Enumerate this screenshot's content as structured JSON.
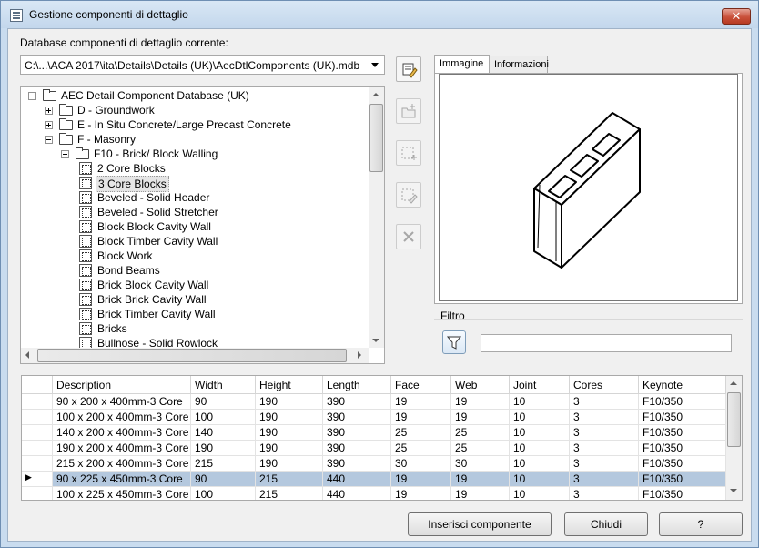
{
  "window": {
    "title": "Gestione componenti di dettaglio",
    "close_glyph": "✕"
  },
  "database": {
    "label": "Database componenti di dettaglio corrente:",
    "value": "C:\\...\\ACA 2017\\ita\\Details\\Details (UK)\\AecDtlComponents (UK).mdb"
  },
  "tree": {
    "items": [
      {
        "label": "AEC Detail Component Database (UK)",
        "level": 0,
        "toggle": "minus",
        "icon": "folder"
      },
      {
        "label": "D - Groundwork",
        "level": 1,
        "toggle": "plus",
        "icon": "folder"
      },
      {
        "label": "E - In Situ Concrete/Large Precast Concrete",
        "level": 1,
        "toggle": "plus",
        "icon": "folder"
      },
      {
        "label": "F - Masonry",
        "level": 1,
        "toggle": "minus",
        "icon": "folder"
      },
      {
        "label": "F10 - Brick/ Block Walling",
        "level": 2,
        "toggle": "minus",
        "icon": "folder"
      },
      {
        "label": "2 Core Blocks",
        "level": 3,
        "toggle": "",
        "icon": "component"
      },
      {
        "label": "3 Core Blocks",
        "level": 3,
        "toggle": "",
        "icon": "component",
        "selected": true
      },
      {
        "label": "Beveled - Solid Header",
        "level": 3,
        "toggle": "",
        "icon": "component"
      },
      {
        "label": "Beveled - Solid Stretcher",
        "level": 3,
        "toggle": "",
        "icon": "component"
      },
      {
        "label": "Block Block Cavity Wall",
        "level": 3,
        "toggle": "",
        "icon": "component"
      },
      {
        "label": "Block Timber Cavity Wall",
        "level": 3,
        "toggle": "",
        "icon": "component"
      },
      {
        "label": "Block Work",
        "level": 3,
        "toggle": "",
        "icon": "component"
      },
      {
        "label": "Bond Beams",
        "level": 3,
        "toggle": "",
        "icon": "component"
      },
      {
        "label": "Brick Block Cavity Wall",
        "level": 3,
        "toggle": "",
        "icon": "component"
      },
      {
        "label": "Brick Brick Cavity Wall",
        "level": 3,
        "toggle": "",
        "icon": "component"
      },
      {
        "label": "Brick Timber Cavity Wall",
        "level": 3,
        "toggle": "",
        "icon": "component"
      },
      {
        "label": "Bricks",
        "level": 3,
        "toggle": "",
        "icon": "component"
      },
      {
        "label": "Bullnose - Solid Rowlock",
        "level": 3,
        "toggle": "",
        "icon": "component"
      }
    ]
  },
  "toolbar": {
    "buttons": [
      {
        "name": "edit-database-button",
        "icon": "edit-database-icon"
      },
      {
        "name": "new-category-button",
        "icon": "new-folder-icon"
      },
      {
        "name": "new-component-button",
        "icon": "new-component-icon"
      },
      {
        "name": "edit-component-button",
        "icon": "edit-component-icon"
      },
      {
        "name": "delete-button",
        "icon": "delete-icon"
      }
    ]
  },
  "tabs": [
    {
      "label": "Immagine",
      "active": true
    },
    {
      "label": "Informazioni",
      "active": false
    }
  ],
  "filter": {
    "label": "Filtro",
    "value": ""
  },
  "table": {
    "columns": [
      "Description",
      "Width",
      "Height",
      "Length",
      "Face",
      "Web",
      "Joint",
      "Cores",
      "Keynote"
    ],
    "rows": [
      [
        "90 x 200 x 400mm-3 Core",
        "90",
        "190",
        "390",
        "19",
        "19",
        "10",
        "3",
        "F10/350"
      ],
      [
        "100 x 200 x 400mm-3 Core",
        "100",
        "190",
        "390",
        "19",
        "19",
        "10",
        "3",
        "F10/350"
      ],
      [
        "140 x 200 x 400mm-3 Core",
        "140",
        "190",
        "390",
        "25",
        "25",
        "10",
        "3",
        "F10/350"
      ],
      [
        "190 x 200 x 400mm-3 Core",
        "190",
        "190",
        "390",
        "25",
        "25",
        "10",
        "3",
        "F10/350"
      ],
      [
        "215 x 200 x 400mm-3 Core",
        "215",
        "190",
        "390",
        "30",
        "30",
        "10",
        "3",
        "F10/350"
      ],
      [
        "90 x 225 x 450mm-3 Core",
        "90",
        "215",
        "440",
        "19",
        "19",
        "10",
        "3",
        "F10/350"
      ],
      [
        "100 x 225 x 450mm-3 Core",
        "100",
        "215",
        "440",
        "19",
        "19",
        "10",
        "3",
        "F10/350"
      ]
    ],
    "selected_row_marker": "▶"
  },
  "buttons": {
    "insert": "Inserisci componente",
    "close": "Chiudi",
    "help": "?"
  },
  "colors": {
    "selection": "#b4c8de",
    "window_frame": "#c9dcef",
    "close_button": "#c9503a"
  }
}
